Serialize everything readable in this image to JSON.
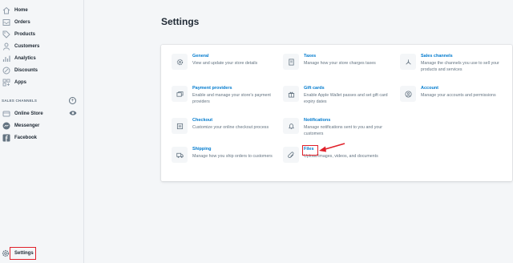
{
  "sidebar": {
    "items": [
      {
        "label": "Home",
        "icon": "home-icon"
      },
      {
        "label": "Orders",
        "icon": "orders-icon"
      },
      {
        "label": "Products",
        "icon": "tag-icon"
      },
      {
        "label": "Customers",
        "icon": "person-icon"
      },
      {
        "label": "Analytics",
        "icon": "bar-chart-icon"
      },
      {
        "label": "Discounts",
        "icon": "discount-icon"
      },
      {
        "label": "Apps",
        "icon": "apps-icon"
      }
    ],
    "sales_channels_heading": "SALES CHANNELS",
    "channels": [
      {
        "label": "Online Store",
        "icon": "store-icon"
      },
      {
        "label": "Messenger",
        "icon": "messenger-icon"
      },
      {
        "label": "Facebook",
        "icon": "facebook-icon"
      }
    ],
    "settings_label": "Settings"
  },
  "main": {
    "title": "Settings",
    "tiles": [
      {
        "title": "General",
        "desc": "View and update your store details",
        "icon": "gear-icon"
      },
      {
        "title": "Taxes",
        "desc": "Manage how your store charges taxes",
        "icon": "receipt-icon"
      },
      {
        "title": "Sales channels",
        "desc": "Manage the channels you use to sell your products and services",
        "icon": "channels-icon"
      },
      {
        "title": "Payment providers",
        "desc": "Enable and manage your store's payment providers",
        "icon": "payment-icon"
      },
      {
        "title": "Gift cards",
        "desc": "Enable Apple Wallet passes and set gift card expiry dates",
        "icon": "gift-icon"
      },
      {
        "title": "Account",
        "desc": "Manage your accounts and permissions",
        "icon": "account-icon"
      },
      {
        "title": "Checkout",
        "desc": "Customize your online checkout process",
        "icon": "cart-icon"
      },
      {
        "title": "Notifications",
        "desc": "Manage notifications sent to you and your customers",
        "icon": "bell-icon"
      },
      {
        "title": "Shipping",
        "desc": "Manage how you ship orders to customers",
        "icon": "truck-icon"
      },
      {
        "title": "Files",
        "desc": "Upload images, videos, and documents",
        "icon": "paperclip-icon"
      }
    ]
  },
  "colors": {
    "accent": "#007ace",
    "highlight": "#e0202a"
  }
}
